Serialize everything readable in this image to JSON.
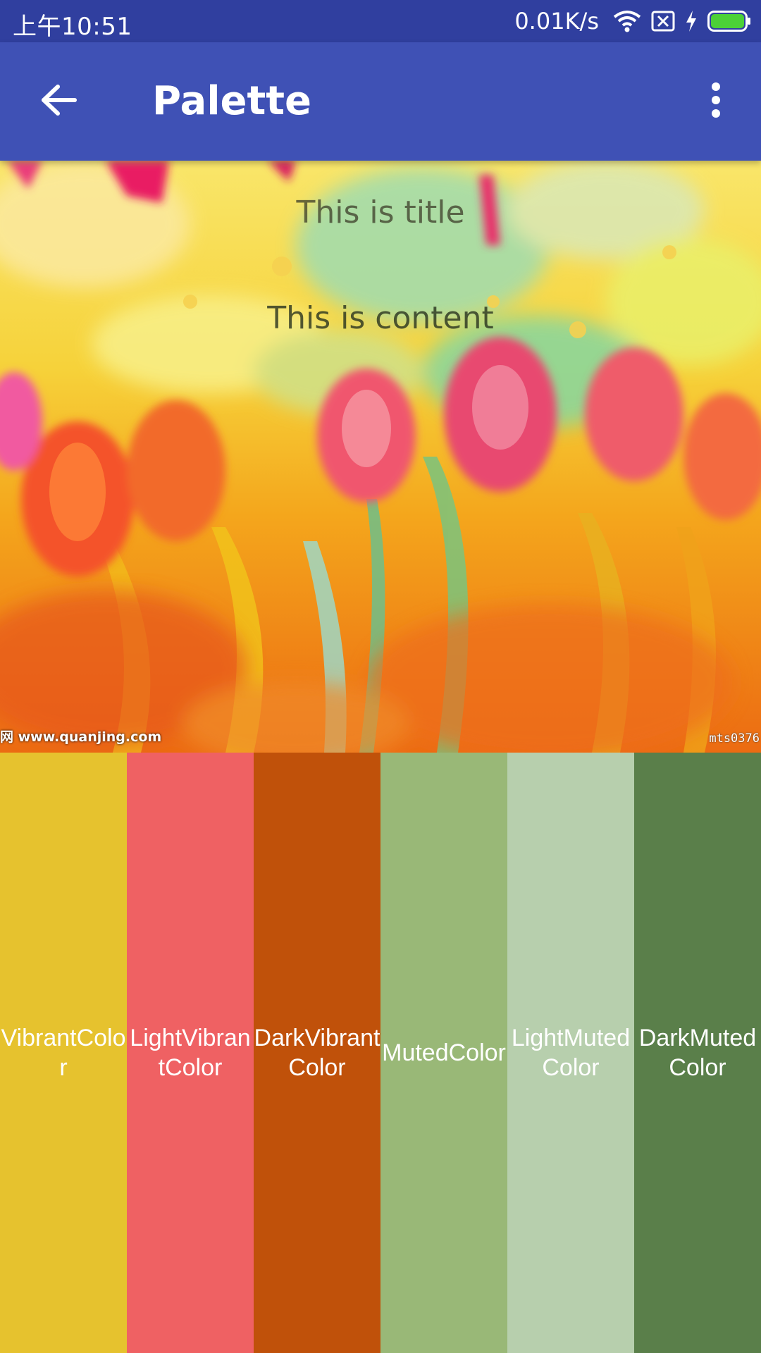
{
  "status_bar": {
    "time": "上午10:51",
    "network_speed": "0.01K/s",
    "icons": [
      "wifi-icon",
      "no-sim-icon",
      "charging-icon",
      "battery-icon"
    ],
    "battery_color": "#4cd137"
  },
  "app_bar": {
    "title": "Palette",
    "back_icon": "arrow-left-icon",
    "menu_icon": "more-vert-icon",
    "background": "#3f51b5"
  },
  "hero": {
    "title": "This is title",
    "content": "This is content",
    "watermark_left": "网 www.quanjing.com",
    "watermark_right": "mts0376"
  },
  "swatches": [
    {
      "label": "VibrantColor",
      "color": "#e6c22e"
    },
    {
      "label": "LightVibrantColor",
      "color": "#ef6163"
    },
    {
      "label": "DarkVibrantColor",
      "color": "#c0510a"
    },
    {
      "label": "MutedColor",
      "color": "#99b877"
    },
    {
      "label": "LightMutedColor",
      "color": "#b7cfad"
    },
    {
      "label": "DarkMutedColor",
      "color": "#5a7f4a"
    }
  ]
}
